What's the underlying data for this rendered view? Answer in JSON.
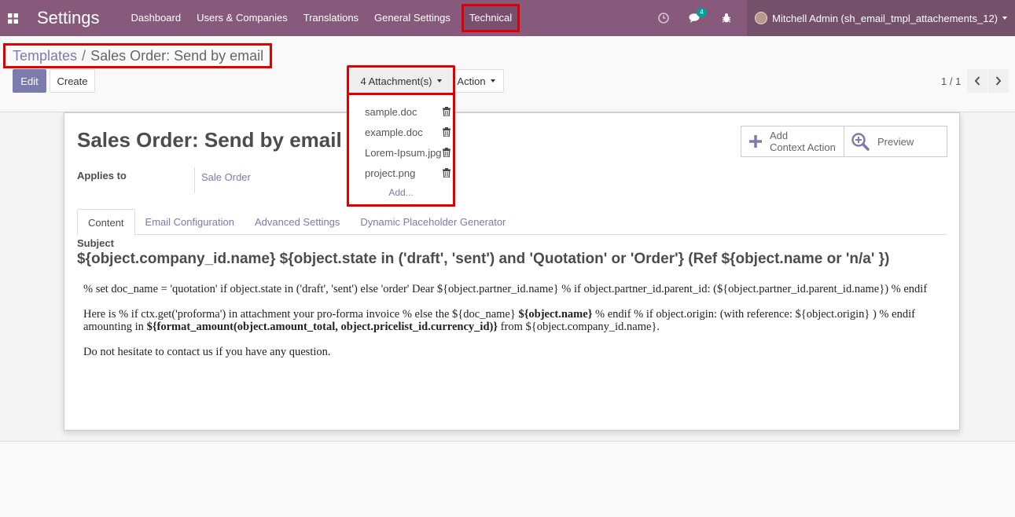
{
  "navbar": {
    "brand": "Settings",
    "menu": [
      "Dashboard",
      "Users & Companies",
      "Translations",
      "General Settings",
      "Technical"
    ],
    "messages_count": "4",
    "user": "Mitchell Admin (sh_email_tmpl_attachements_12)"
  },
  "breadcrumb": {
    "parent": "Templates",
    "separator": "/",
    "current": "Sales Order: Send by email"
  },
  "toolbar": {
    "edit": "Edit",
    "create": "Create",
    "attachments": "4 Attachment(s)",
    "action": "Action"
  },
  "pager": {
    "value": "1 / 1"
  },
  "attachments_dropdown": {
    "items": [
      "sample.doc",
      "example.doc",
      "Lorem-Ipsum.jpg",
      "project.png"
    ],
    "add": "Add..."
  },
  "form": {
    "title": "Sales Order: Send by email",
    "button_box": {
      "add_context_line1": "Add",
      "add_context_line2": "Context Action",
      "preview": "Preview"
    },
    "applies_to_label": "Applies to",
    "applies_to_value": "Sale Order",
    "tabs": [
      "Content",
      "Email Configuration",
      "Advanced Settings",
      "Dynamic Placeholder Generator"
    ],
    "subject_label": "Subject",
    "subject_value": "${object.company_id.name} ${object.state in ('draft', 'sent') and 'Quotation' or 'Order'} (Ref ${object.name or 'n/a' })",
    "body": {
      "p1": "% set doc_name = 'quotation' if object.state in ('draft', 'sent') else 'order' Dear ${object.partner_id.name} % if object.partner_id.parent_id: (${object.partner_id.parent_id.name}) % endif",
      "p2_a": "Here is % if ctx.get('proforma') in attachment your pro-forma invoice % else the ${doc_name} ",
      "p2_b": "${object.name}",
      "p2_c": " % endif % if object.origin: (with reference: ${object.origin} ) % endif amounting in ",
      "p2_d": "${format_amount(object.amount_total, object.pricelist_id.currency_id)}",
      "p2_e": " from ${object.company_id.name}.",
      "p3": "Do not hesitate to contact us if you have any question."
    }
  },
  "colors": {
    "navbar": "#875a7b",
    "primary": "#7c7bad",
    "highlight_border": "#e00000"
  }
}
